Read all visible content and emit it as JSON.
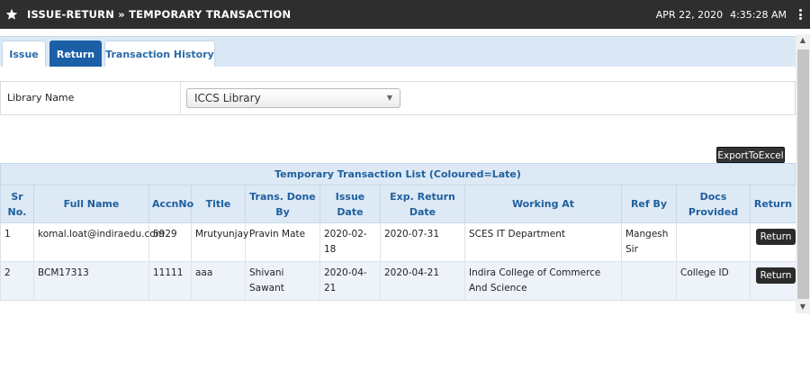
{
  "header": {
    "title": "ISSUE-RETURN » TEMPORARY TRANSACTION",
    "date": "APR 22, 2020",
    "time": "4:35:28 AM",
    "star_icon": "star-icon",
    "menu_icon": "kebab-menu-icon"
  },
  "tabs": [
    {
      "label": "Issue",
      "active": false
    },
    {
      "label": "Return",
      "active": true
    },
    {
      "label": "Transaction History",
      "active": false
    }
  ],
  "form": {
    "library_label": "Library Name",
    "library_value": "ICCS Library"
  },
  "export_label": "ExportToExcel",
  "grid": {
    "caption": "Temporary Transaction List (Coloured=Late)",
    "headers": [
      "Sr No.",
      "Full Name",
      "AccnNo",
      "Title",
      "Trans. Done By",
      "Issue Date",
      "Exp. Return Date",
      "Working At",
      "Ref By",
      "Docs Provided",
      "Return"
    ],
    "rows": [
      {
        "sr": "1",
        "name": "komal.loat@indiraedu.com",
        "accn": "5929",
        "title": "Mrutyunjay",
        "by": "Pravin Mate",
        "issue": "2020-02-18",
        "exp": "2020-07-31",
        "work": "SCES IT Department",
        "ref": "Mangesh Sir",
        "docs": "",
        "action": "Return"
      },
      {
        "sr": "2",
        "name": "BCM17313",
        "accn": "11111",
        "title": "aaa",
        "by": "Shivani Sawant",
        "issue": "2020-04-21",
        "exp": "2020-04-21",
        "work": "Indira College of Commerce And Science",
        "ref": "",
        "docs": "College ID",
        "action": "Return"
      }
    ]
  },
  "colors": {
    "titlebar": "#2e2e2e",
    "active_tab": "#1b5fa6",
    "header_text": "#1f5f9e",
    "header_bg": "#dde9f5"
  }
}
